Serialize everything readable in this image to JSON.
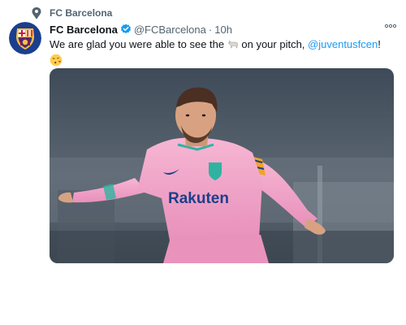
{
  "context": {
    "label": "FC Barcelona",
    "icon": "pin-icon"
  },
  "author": {
    "display_name": "FC Barcelona",
    "handle": "@FCBarcelona",
    "separator": "·",
    "time": "10h",
    "verified": true,
    "avatar": "fc-barcelona-crest"
  },
  "tweet": {
    "text_before": "We are glad you were able to see the",
    "goat": "goat-emoji",
    "text_middle": "on your pitch,",
    "mention": "@juventusfcen",
    "text_end": "!",
    "emoji": "face-blowing-kiss-emoji"
  },
  "media": {
    "kind": "photo",
    "shirt_text": "Rakuten"
  },
  "colors": {
    "accent": "#1d9bf0",
    "text": "#0f1419",
    "muted": "#536471",
    "shirt_pink": "#f2a3c7"
  }
}
